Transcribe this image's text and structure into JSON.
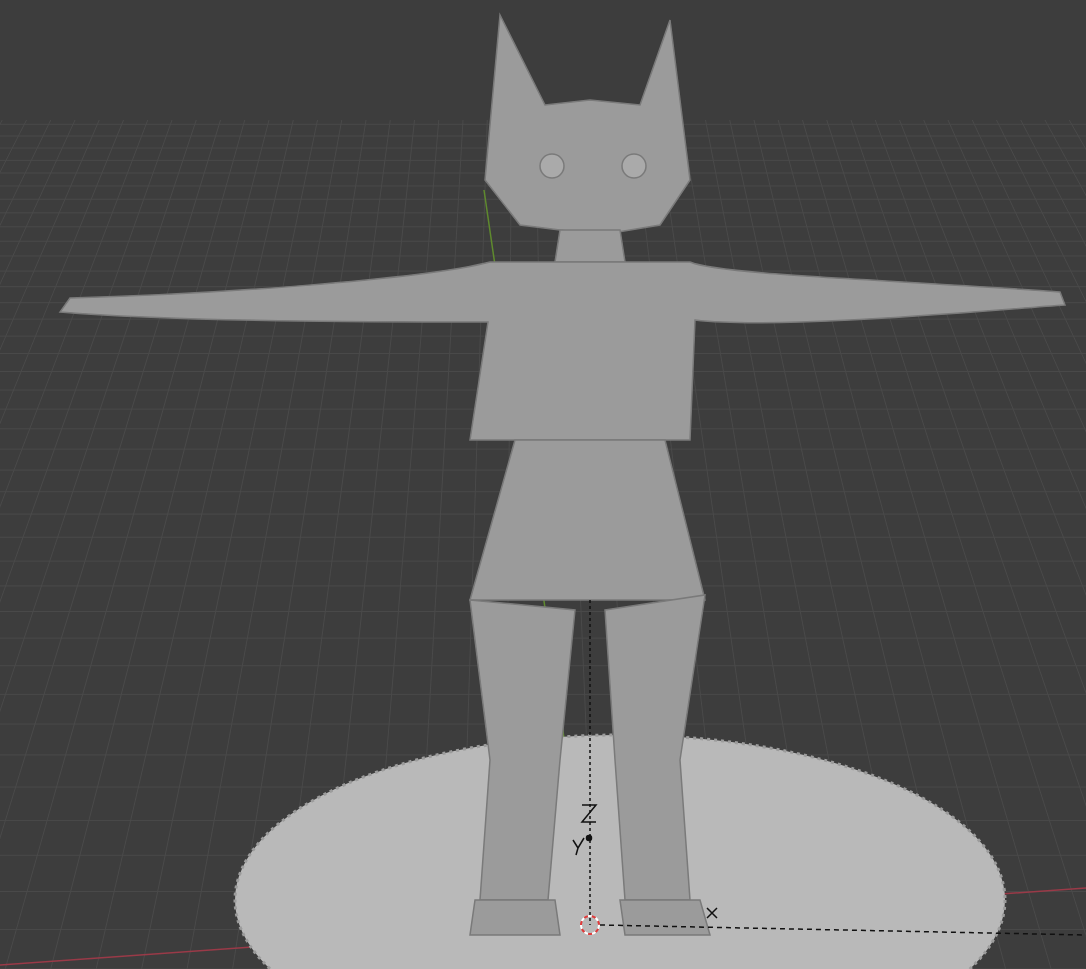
{
  "viewport": {
    "grid": true,
    "floor_axes": true,
    "cursor_3d": true,
    "empty_axes": true
  }
}
